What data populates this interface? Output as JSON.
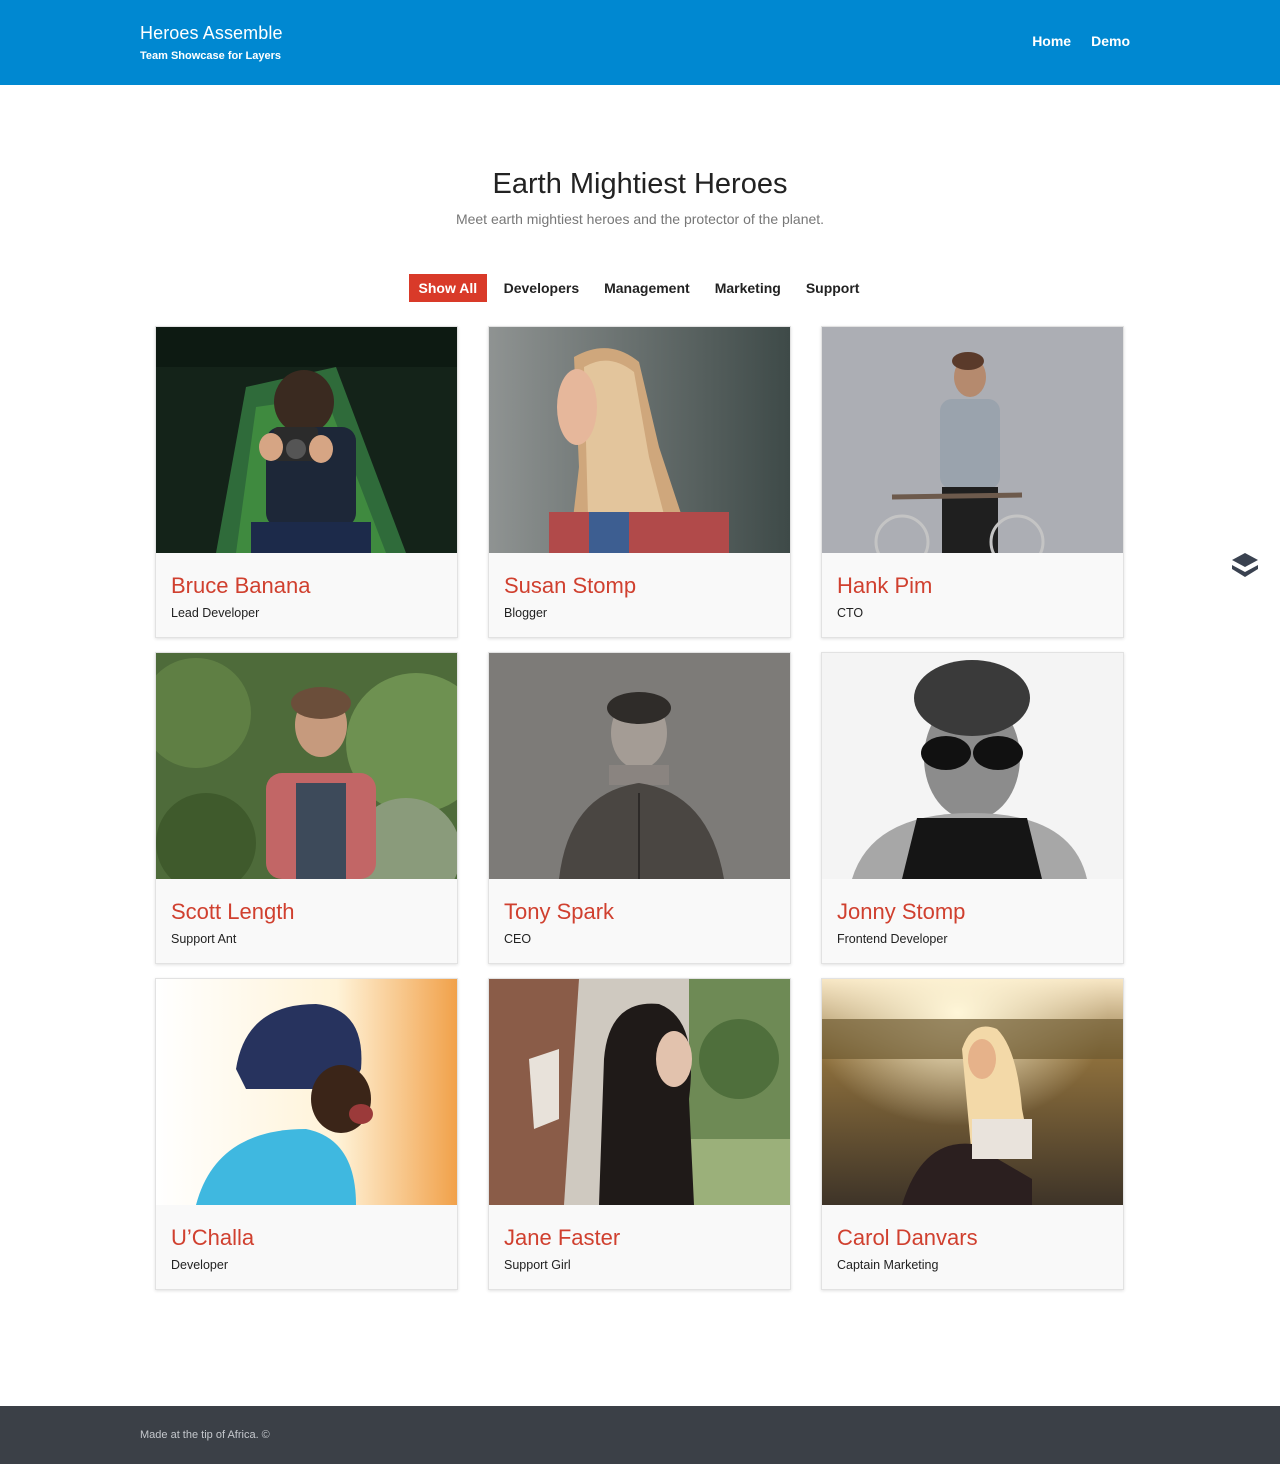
{
  "header": {
    "brand_title": "Heroes Assemble",
    "brand_tagline": "Team Showcase for Layers",
    "nav": [
      "Home",
      "Demo"
    ],
    "background": "#0088d1"
  },
  "section": {
    "title": "Earth Mightiest Heroes",
    "subtitle": "Meet earth mightiest heroes and the protector of the planet."
  },
  "filters": {
    "items": [
      "Show All",
      "Developers",
      "Management",
      "Marketing",
      "Support"
    ],
    "active": "Show All",
    "active_color": "#d93a29"
  },
  "team": [
    {
      "name": "Bruce Banana",
      "role": "Lead Developer"
    },
    {
      "name": "Susan Stomp",
      "role": "Blogger"
    },
    {
      "name": "Hank Pim",
      "role": "CTO"
    },
    {
      "name": "Scott Length",
      "role": "Support Ant"
    },
    {
      "name": "Tony Spark",
      "role": "CEO"
    },
    {
      "name": "Jonny Stomp",
      "role": "Frontend Developer"
    },
    {
      "name": "U’Challa",
      "role": "Developer"
    },
    {
      "name": "Jane Faster",
      "role": "Support Girl"
    },
    {
      "name": "Carol Danvars",
      "role": "Captain Marketing"
    }
  ],
  "name_color": "#d0402f",
  "side_icon": "layers-icon",
  "footer": {
    "text": "Made at the tip of Africa. ©"
  }
}
